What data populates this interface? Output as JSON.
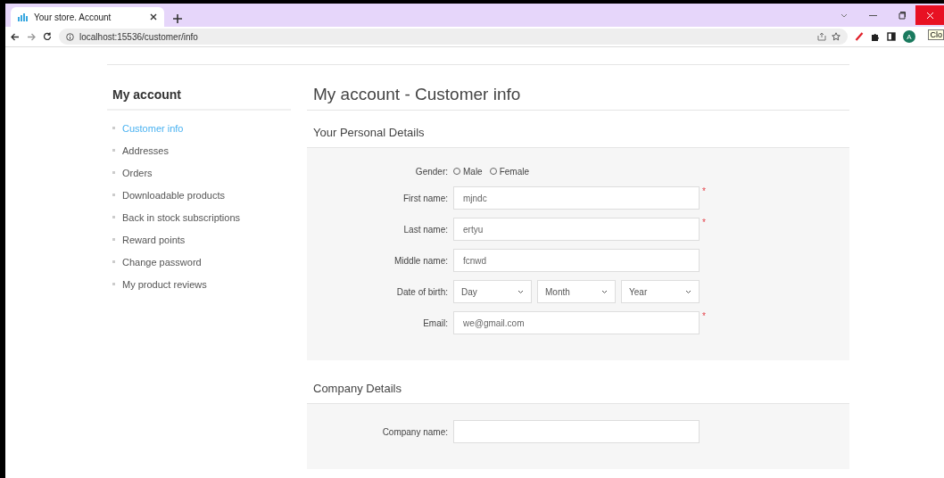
{
  "browser": {
    "tabs": [
      {
        "title": "Your store. Account",
        "selected": true
      }
    ],
    "address": "localhost:15536/customer/info",
    "profile_initial": "A",
    "tooltip": "Clo"
  },
  "sidebar": {
    "title": "My account",
    "items": [
      {
        "label": "Customer info",
        "selected": true
      },
      {
        "label": "Addresses",
        "selected": false
      },
      {
        "label": "Orders",
        "selected": false
      },
      {
        "label": "Downloadable products",
        "selected": false
      },
      {
        "label": "Back in stock subscriptions",
        "selected": false
      },
      {
        "label": "Reward points",
        "selected": false
      },
      {
        "label": "Change password",
        "selected": false
      },
      {
        "label": "My product reviews",
        "selected": false
      }
    ]
  },
  "page_title": "My account - Customer info",
  "sections": [
    {
      "title": "Your Personal Details",
      "fields": [
        {
          "kind": "radio",
          "label": "Gender:",
          "options": [
            {
              "label": "Male",
              "selected": false
            },
            {
              "label": "Female",
              "selected": false
            }
          ]
        },
        {
          "kind": "text",
          "label": "First name:",
          "value": "mjndc",
          "required_mark": "*"
        },
        {
          "kind": "text",
          "label": "Last name:",
          "value": "ertyu",
          "required_mark": "*"
        },
        {
          "kind": "text",
          "label": "Middle name:",
          "value": "fcnwd"
        },
        {
          "kind": "date",
          "label": "Date of birth:",
          "selects": [
            "Day",
            "Month",
            "Year"
          ]
        },
        {
          "kind": "text",
          "label": "Email:",
          "value": "we@gmail.com",
          "required_mark": "*"
        }
      ]
    },
    {
      "title": "Company Details",
      "fields": [
        {
          "kind": "text",
          "label": "Company name:"
        }
      ]
    }
  ]
}
